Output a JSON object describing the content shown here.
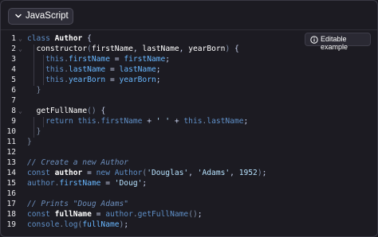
{
  "toolbar": {
    "language_label": "JavaScript",
    "language_icon": "chevron-down-icon"
  },
  "badge": {
    "label": "Editable example",
    "icon": "info-icon"
  },
  "colors": {
    "keyword": "#5f8fc7",
    "property": "#68b7ff",
    "string": "#b7e3ff",
    "comment": "#6d8fbd",
    "background": "#1c1b22"
  },
  "lines": [
    {
      "n": "1",
      "fold": true,
      "tokens": [
        [
          "kw",
          "class "
        ],
        [
          "cls",
          "Author"
        ],
        [
          "plain",
          " {"
        ]
      ]
    },
    {
      "n": "2",
      "fold": true,
      "tokens": [
        [
          "plain",
          "  "
        ],
        [
          "fn",
          "constructor"
        ],
        [
          "punc",
          "("
        ],
        [
          "fn",
          "firstName"
        ],
        [
          "plain",
          ", "
        ],
        [
          "fn",
          "lastName"
        ],
        [
          "plain",
          ", "
        ],
        [
          "fn",
          "yearBorn"
        ],
        [
          "punc",
          ")"
        ],
        [
          "plain",
          " {"
        ]
      ]
    },
    {
      "n": "3",
      "fold": false,
      "tokens": [
        [
          "plain",
          "    "
        ],
        [
          "kw",
          "this"
        ],
        [
          "punc",
          "."
        ],
        [
          "prop",
          "firstName"
        ],
        [
          "plain",
          " = "
        ],
        [
          "prop",
          "firstName"
        ],
        [
          "plain",
          ";"
        ]
      ]
    },
    {
      "n": "4",
      "fold": false,
      "tokens": [
        [
          "plain",
          "    "
        ],
        [
          "kw",
          "this"
        ],
        [
          "punc",
          "."
        ],
        [
          "prop",
          "lastName"
        ],
        [
          "plain",
          " = "
        ],
        [
          "prop",
          "lastName"
        ],
        [
          "plain",
          ";"
        ]
      ]
    },
    {
      "n": "5",
      "fold": false,
      "tokens": [
        [
          "plain",
          "    "
        ],
        [
          "kw",
          "this"
        ],
        [
          "punc",
          "."
        ],
        [
          "prop",
          "yearBorn"
        ],
        [
          "plain",
          " = "
        ],
        [
          "prop",
          "yearBorn"
        ],
        [
          "plain",
          ";"
        ]
      ]
    },
    {
      "n": "6",
      "fold": false,
      "tokens": [
        [
          "plain",
          "  "
        ],
        [
          "punc",
          "}"
        ]
      ]
    },
    {
      "n": "7",
      "fold": false,
      "tokens": []
    },
    {
      "n": "8",
      "fold": true,
      "tokens": [
        [
          "plain",
          "  "
        ],
        [
          "fn",
          "getFullName"
        ],
        [
          "punc",
          "()"
        ],
        [
          "plain",
          " {"
        ]
      ]
    },
    {
      "n": "9",
      "fold": false,
      "tokens": [
        [
          "plain",
          "    "
        ],
        [
          "kw",
          "return this"
        ],
        [
          "punc",
          "."
        ],
        [
          "kw",
          "firstName"
        ],
        [
          "plain",
          " + "
        ],
        [
          "str",
          "' '"
        ],
        [
          "plain",
          " + "
        ],
        [
          "kw",
          "this"
        ],
        [
          "punc",
          "."
        ],
        [
          "kw",
          "lastName"
        ],
        [
          "plain",
          ";"
        ]
      ]
    },
    {
      "n": "10",
      "fold": false,
      "tokens": [
        [
          "plain",
          "  "
        ],
        [
          "punc",
          "}"
        ]
      ]
    },
    {
      "n": "11",
      "fold": false,
      "tokens": [
        [
          "punc",
          "}"
        ]
      ]
    },
    {
      "n": "12",
      "fold": false,
      "tokens": []
    },
    {
      "n": "13",
      "fold": false,
      "tokens": [
        [
          "com",
          "// Create a new Author"
        ]
      ]
    },
    {
      "n": "14",
      "fold": false,
      "tokens": [
        [
          "kw",
          "const "
        ],
        [
          "cls",
          "author"
        ],
        [
          "plain",
          " = "
        ],
        [
          "kw",
          "new "
        ],
        [
          "kw",
          "Author"
        ],
        [
          "punc",
          "("
        ],
        [
          "str",
          "'Douglas'"
        ],
        [
          "plain",
          ", "
        ],
        [
          "str",
          "'Adams'"
        ],
        [
          "plain",
          ", "
        ],
        [
          "num",
          "1952"
        ],
        [
          "punc",
          ")"
        ],
        [
          "plain",
          ";"
        ]
      ]
    },
    {
      "n": "15",
      "fold": false,
      "tokens": [
        [
          "kw",
          "author"
        ],
        [
          "punc",
          "."
        ],
        [
          "prop",
          "firstName"
        ],
        [
          "plain",
          " = "
        ],
        [
          "str",
          "'Doug'"
        ],
        [
          "plain",
          ";"
        ]
      ]
    },
    {
      "n": "16",
      "fold": false,
      "tokens": []
    },
    {
      "n": "17",
      "fold": false,
      "tokens": [
        [
          "com",
          "// Prints \"Doug Adams\""
        ]
      ]
    },
    {
      "n": "18",
      "fold": false,
      "tokens": [
        [
          "kw",
          "const "
        ],
        [
          "cls",
          "fullName"
        ],
        [
          "plain",
          " = "
        ],
        [
          "kw",
          "author"
        ],
        [
          "punc",
          "."
        ],
        [
          "kw",
          "getFullName"
        ],
        [
          "punc",
          "()"
        ],
        [
          "plain",
          ";"
        ]
      ]
    },
    {
      "n": "19",
      "fold": false,
      "tokens": [
        [
          "kw",
          "console"
        ],
        [
          "punc",
          "."
        ],
        [
          "kw",
          "log"
        ],
        [
          "punc",
          "("
        ],
        [
          "prop",
          "fullName"
        ],
        [
          "punc",
          ")"
        ],
        [
          "plain",
          ";"
        ]
      ]
    }
  ]
}
